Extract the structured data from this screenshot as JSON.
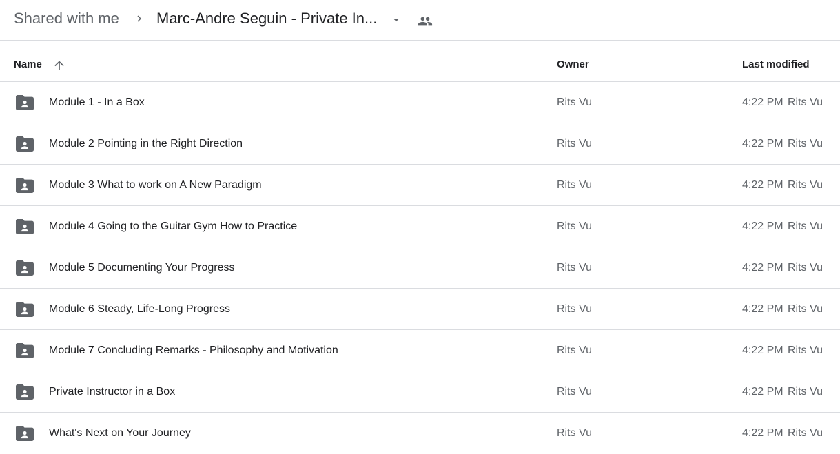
{
  "breadcrumb": {
    "root": "Shared with me",
    "current": "Marc-Andre Seguin - Private In...",
    "separator_icon": "chevron-right-icon",
    "dropdown_icon": "caret-down-icon",
    "shared_icon": "people-icon"
  },
  "columns": {
    "name": "Name",
    "owner": "Owner",
    "last_modified": "Last modified",
    "sort_icon": "arrow-up-icon"
  },
  "rows": [
    {
      "name": "Module 1 - In a Box",
      "owner": "Rits Vu",
      "time": "4:22 PM",
      "modifier": "Rits Vu"
    },
    {
      "name": "Module 2 Pointing in the Right Direction",
      "owner": "Rits Vu",
      "time": "4:22 PM",
      "modifier": "Rits Vu"
    },
    {
      "name": "Module 3 What to work on A New Paradigm",
      "owner": "Rits Vu",
      "time": "4:22 PM",
      "modifier": "Rits Vu"
    },
    {
      "name": "Module 4 Going to the Guitar Gym How to Practice",
      "owner": "Rits Vu",
      "time": "4:22 PM",
      "modifier": "Rits Vu"
    },
    {
      "name": "Module 5 Documenting Your Progress",
      "owner": "Rits Vu",
      "time": "4:22 PM",
      "modifier": "Rits Vu"
    },
    {
      "name": "Module 6 Steady, Life-Long Progress",
      "owner": "Rits Vu",
      "time": "4:22 PM",
      "modifier": "Rits Vu"
    },
    {
      "name": "Module 7 Concluding Remarks - Philosophy and Motivation",
      "owner": "Rits Vu",
      "time": "4:22 PM",
      "modifier": "Rits Vu"
    },
    {
      "name": "Private Instructor in a Box",
      "owner": "Rits Vu",
      "time": "4:22 PM",
      "modifier": "Rits Vu"
    },
    {
      "name": "What's Next on Your Journey",
      "owner": "Rits Vu",
      "time": "4:22 PM",
      "modifier": "Rits Vu"
    }
  ],
  "colors": {
    "icon": "#5f6368",
    "divider": "#dadce0",
    "text_primary": "#202124",
    "text_secondary": "#5f6368"
  }
}
